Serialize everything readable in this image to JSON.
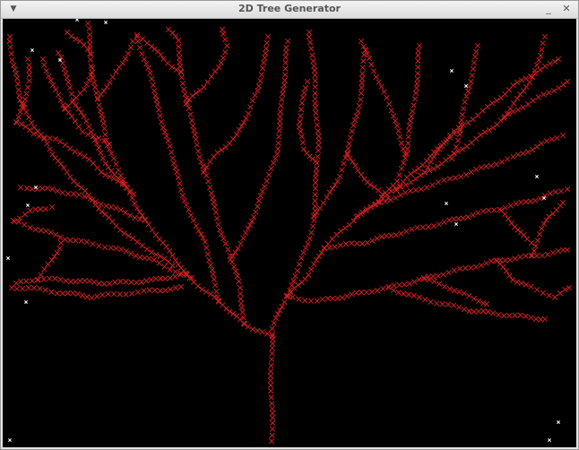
{
  "window": {
    "title": "2D Tree Generator",
    "menu_icon": "triangle-down-icon",
    "minimize_icon": "underscore-icon",
    "close_icon": "x-icon"
  },
  "colors": {
    "background": "#000000",
    "branch_marker": "#cc2020",
    "attractor_point": "#ffffff"
  },
  "canvas": {
    "description_markers": "red x markers forming tree branches",
    "white_points_count": 17
  }
}
